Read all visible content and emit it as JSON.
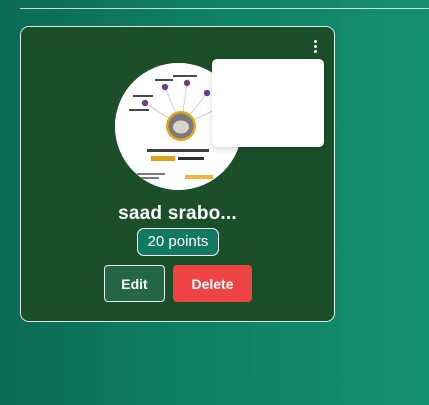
{
  "card": {
    "name": "saad srabo...",
    "points_label": "20 points",
    "edit_label": "Edit",
    "delete_label": "Delete",
    "menu_icon": "kebab-menu-icon"
  },
  "colors": {
    "page_gradient_start": "#0b6a55",
    "page_gradient_end": "#14906f",
    "card_background": "#1a4f2a",
    "points_badge": "#107a5e",
    "edit_button": "#246747",
    "delete_button": "#ef4444"
  }
}
